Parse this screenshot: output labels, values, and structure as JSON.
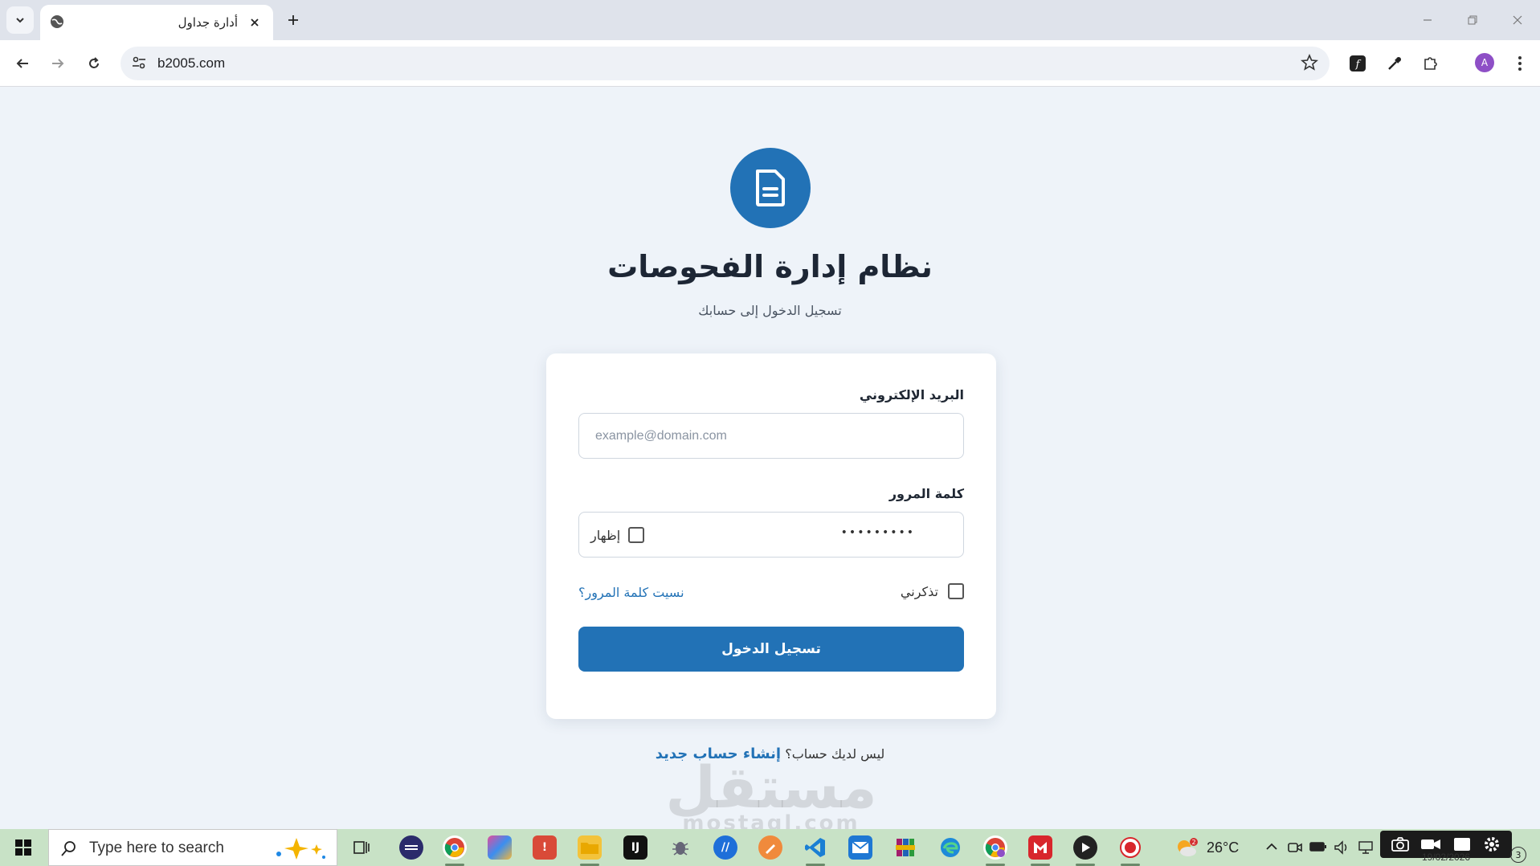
{
  "browser": {
    "tab_title": "أدارة جداول",
    "url": "b2005.com",
    "profile_initial": "A"
  },
  "page": {
    "logo_icon": "document-icon",
    "title": "نظام إدارة الفحوصات",
    "subtitle": "تسجيل الدخول إلى حسابك"
  },
  "form": {
    "email_label": "البريد الإلكتروني",
    "email_placeholder": "example@domain.com",
    "email_value": "",
    "password_label": "كلمة المرور",
    "password_masked": "•••••••••",
    "show_label": "إظهار",
    "show_checked": false,
    "remember_label": "تذكرني",
    "remember_checked": false,
    "forgot_link": "نسيت كلمة المرور؟",
    "submit_label": "تسجيل الدخول"
  },
  "signup": {
    "question": "ليس لديك حساب؟",
    "link": "إنشاء حساب جديد"
  },
  "watermark": {
    "arabic": "مستقل",
    "latin": "mostaql.com"
  },
  "taskbar": {
    "search_placeholder": "Type here to search",
    "weather_temp": "26°C",
    "weather_badge": "2",
    "date": "19/02/2026",
    "notification_count": "3"
  },
  "colors": {
    "accent": "#2272b6",
    "page_bg": "#eef3f9",
    "taskbar_bg": "#c8e2c6"
  }
}
